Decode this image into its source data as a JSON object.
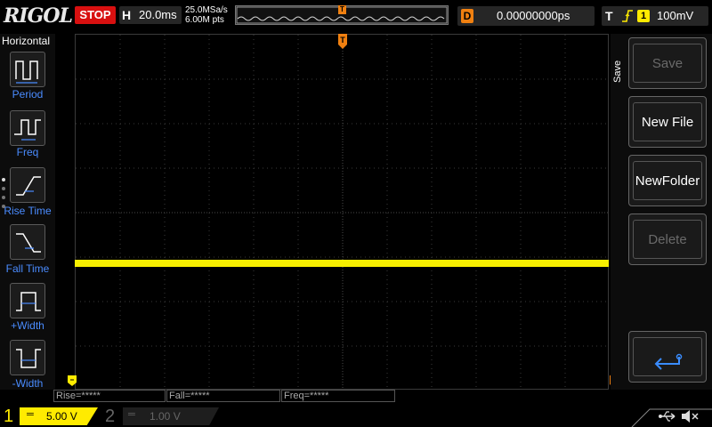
{
  "topbar": {
    "logo": "RIGOL",
    "run_state": "STOP",
    "horizontal_key": "H",
    "timebase": "20.0ms",
    "sample_rate": "25.0MSa/s",
    "memory_depth": "6.00M pts",
    "delay_key": "D",
    "delay_value": "0.00000000ps",
    "trigger_key": "T",
    "trigger_edge_icon": "rising-edge-icon",
    "trigger_channel": "1",
    "trigger_level": "100mV"
  },
  "left_menu": {
    "title": "Horizontal",
    "items": [
      {
        "label": "Period",
        "icon": "period-icon"
      },
      {
        "label": "Freq",
        "icon": "frequency-icon"
      },
      {
        "label": "Rise Time",
        "icon": "rise-time-icon"
      },
      {
        "label": "Fall Time",
        "icon": "fall-time-icon"
      },
      {
        "label": "+Width",
        "icon": "positive-width-icon"
      },
      {
        "label": "-Width",
        "icon": "negative-width-icon"
      }
    ]
  },
  "measurements": {
    "rise": "Rise=*****",
    "fall": "Fall=*****",
    "freq": "Freq=*****"
  },
  "right_menu": {
    "section": "Save",
    "buttons": [
      {
        "label": "Save",
        "enabled": false
      },
      {
        "label": "New File",
        "enabled": true
      },
      {
        "label": "NewFolder",
        "enabled": true
      },
      {
        "label": "Delete",
        "enabled": false
      }
    ],
    "back_icon": "return-arrow-icon"
  },
  "bottom": {
    "ch1_number": "1",
    "ch1_coupling": "═",
    "ch1_scale": "5.00 V",
    "ch2_number": "2",
    "ch2_coupling": "═",
    "ch2_scale": "1.00 V"
  },
  "colors": {
    "ch1": "#ffeb00",
    "stop": "#d81010",
    "trigger_marker": "#f08010",
    "menu_label": "#4a8cff"
  }
}
